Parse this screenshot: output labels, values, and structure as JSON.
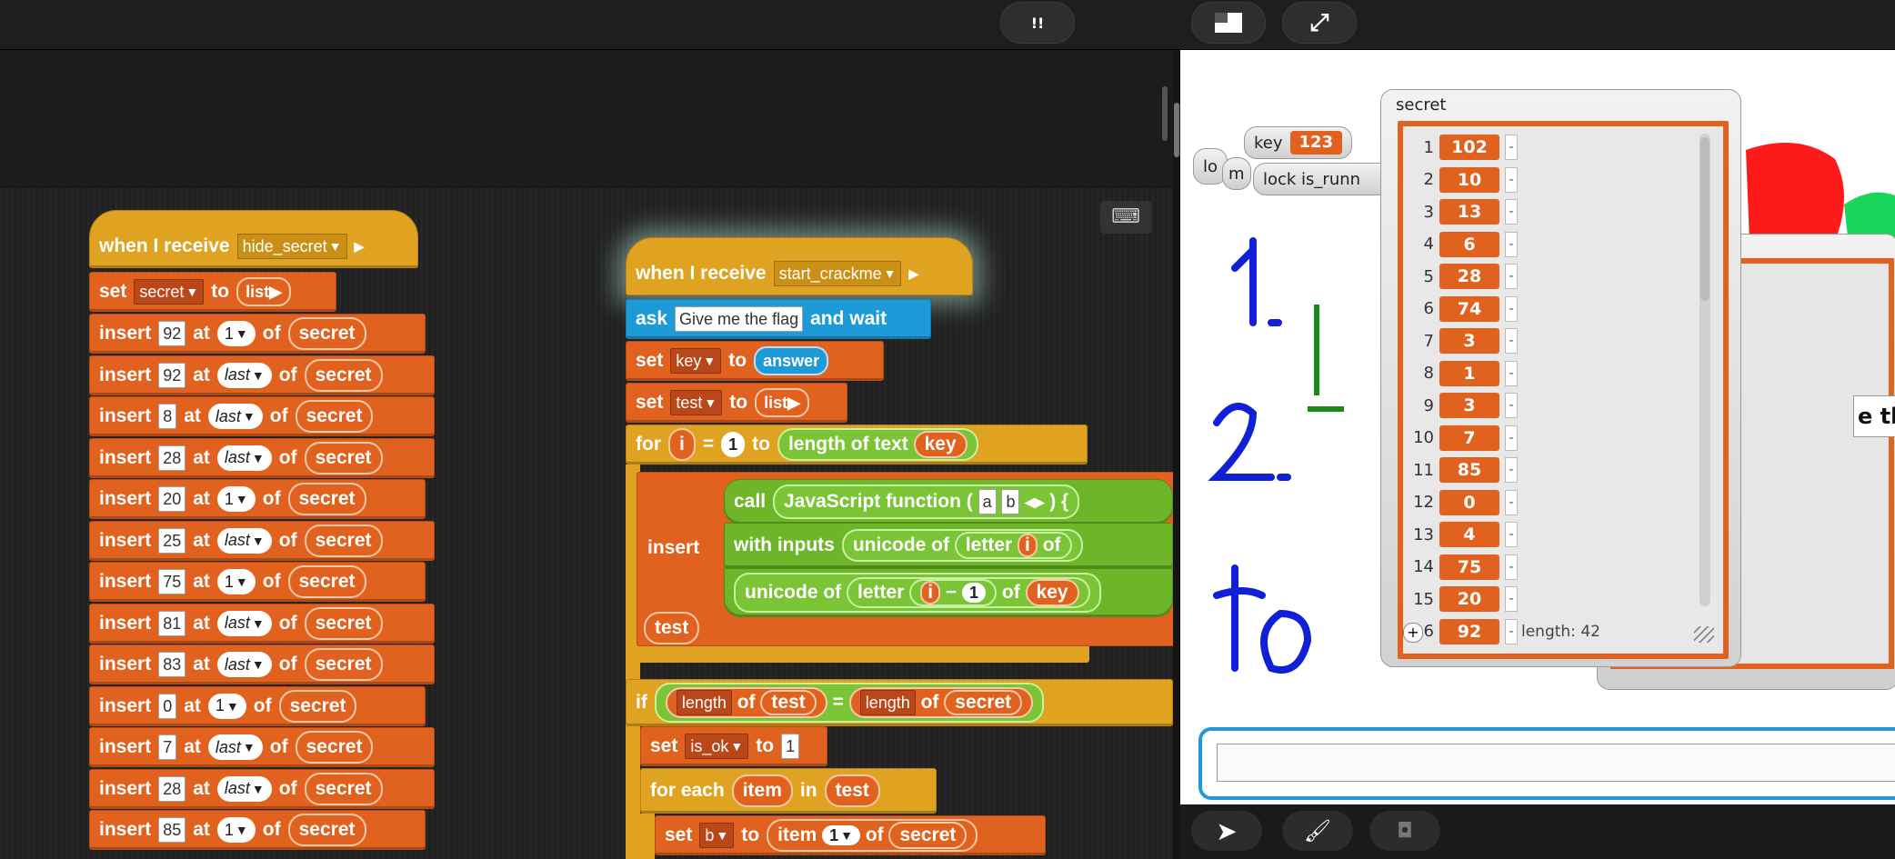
{
  "toolbar": {
    "pause_label": "!!",
    "stage_size_icon": "stage-size-icon",
    "fullscreen_icon": "fullscreen-icon"
  },
  "script1": {
    "hat": {
      "label": "when I receive",
      "message": "hide_secret"
    },
    "set": {
      "label": "set",
      "var": "secret",
      "to": "to",
      "value": "list"
    },
    "inserts": [
      {
        "value": "92",
        "pos": "1"
      },
      {
        "value": "92",
        "pos": "last"
      },
      {
        "value": "8",
        "pos": "last"
      },
      {
        "value": "28",
        "pos": "last"
      },
      {
        "value": "20",
        "pos": "1"
      },
      {
        "value": "25",
        "pos": "last"
      },
      {
        "value": "75",
        "pos": "1"
      },
      {
        "value": "81",
        "pos": "last"
      },
      {
        "value": "83",
        "pos": "last"
      },
      {
        "value": "0",
        "pos": "1"
      },
      {
        "value": "7",
        "pos": "last"
      },
      {
        "value": "28",
        "pos": "last"
      },
      {
        "value": "85",
        "pos": "1"
      }
    ],
    "insert_word": "insert",
    "at_word": "at",
    "of_word": "of",
    "list_name": "secret"
  },
  "script2": {
    "hat": {
      "label": "when I receive",
      "message": "start_crackme"
    },
    "ask": {
      "label": "ask",
      "text": "Give me the flag",
      "and_wait": "and wait"
    },
    "set_key": {
      "label": "set",
      "var": "key",
      "to": "to",
      "value": "answer"
    },
    "set_test": {
      "label": "set",
      "var": "test",
      "to": "to",
      "value": "list"
    },
    "for": {
      "label": "for",
      "var": "i",
      "eq": "=",
      "start": "1",
      "to": "to",
      "end_label": "length of text",
      "end_var": "key"
    },
    "insert_word": "insert",
    "call": {
      "label": "call",
      "fn": "JavaScript function (",
      "p1": "a",
      "p2": "b",
      "brace": ") {"
    },
    "with_inputs": {
      "label": "with inputs",
      "f1": "unicode of",
      "f2": "letter",
      "var": "i",
      "of": "of"
    },
    "unicode2": {
      "label": "unicode of",
      "letter": "letter",
      "var": "i",
      "minus": "−",
      "num": "1",
      "of": "of",
      "key": "key"
    },
    "test": "test",
    "if": {
      "label": "if",
      "len1": "length",
      "of1": "of",
      "v1": "test",
      "eq": "=",
      "len2": "length",
      "of2": "of",
      "v2": "secret"
    },
    "set_ok": {
      "label": "set",
      "var": "is_ok",
      "to": "to",
      "value": "1"
    },
    "foreach": {
      "label": "for each",
      "var": "item",
      "in": "in",
      "list": "test"
    },
    "set_b": {
      "label": "set",
      "var": "b",
      "to": "to",
      "item": "item",
      "idx": "1",
      "of": "of",
      "list": "secret"
    }
  },
  "stage": {
    "watcher_key": {
      "label": "key",
      "value": "123"
    },
    "watcher_lock": {
      "label": "lock is_runn"
    },
    "watcher_lo": "lo",
    "watcher_m": "m",
    "partial_text": "e th",
    "list_title": "secret",
    "list_rows": [
      {
        "i": "1",
        "v": "102"
      },
      {
        "i": "2",
        "v": "10"
      },
      {
        "i": "3",
        "v": "13"
      },
      {
        "i": "4",
        "v": "6"
      },
      {
        "i": "5",
        "v": "28"
      },
      {
        "i": "6",
        "v": "74"
      },
      {
        "i": "7",
        "v": "3"
      },
      {
        "i": "8",
        "v": "1"
      },
      {
        "i": "9",
        "v": "3"
      },
      {
        "i": "10",
        "v": "7"
      },
      {
        "i": "11",
        "v": "85"
      },
      {
        "i": "12",
        "v": "0"
      },
      {
        "i": "13",
        "v": "4"
      },
      {
        "i": "14",
        "v": "75"
      },
      {
        "i": "15",
        "v": "20"
      },
      {
        "i": "16",
        "v": "92"
      }
    ],
    "list_length": "length: 42",
    "add_symbol": "+"
  },
  "stagebar": {
    "go_icon": "go-arrow-icon",
    "paint_icon": "paintbrush-icon",
    "camera_icon": "camera-icon"
  },
  "colors": {
    "control": "#e0a321",
    "variables": "#e0621e",
    "sensing": "#1f9ad8",
    "operators": "#6fb52a"
  }
}
